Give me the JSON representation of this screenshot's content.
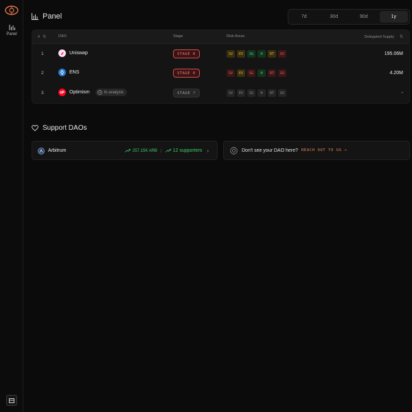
{
  "sidebar": {
    "logo_icon": "eye-logo-icon",
    "nav": [
      {
        "label": "Panel",
        "icon": "bar-chart-icon"
      }
    ],
    "bottom_icon": "sidebar-toggle-icon"
  },
  "header": {
    "title": "Panel",
    "title_icon": "bar-chart-icon",
    "ranges": [
      {
        "label": "7d",
        "active": false
      },
      {
        "label": "30d",
        "active": false
      },
      {
        "label": "90d",
        "active": false
      },
      {
        "label": "1y",
        "active": true
      }
    ]
  },
  "table": {
    "columns": {
      "rank": "#",
      "dao": "DAO",
      "stage": "Stage",
      "risk": "Risk Areas",
      "supply": "Delegated Supply"
    },
    "rows": [
      {
        "rank": "1",
        "name": "Uniswap",
        "icon": "uniswap-icon",
        "stage": "STAGE 0",
        "stage_style": "red",
        "risks": [
          {
            "code": "SV",
            "level": "medium"
          },
          {
            "code": "EV",
            "level": "medium"
          },
          {
            "code": "SG",
            "level": "low"
          },
          {
            "code": "H",
            "level": "low"
          },
          {
            "code": "RT",
            "level": "medium"
          },
          {
            "code": "GV",
            "level": "high"
          }
        ],
        "supply": "195.06M"
      },
      {
        "rank": "2",
        "name": "ENS",
        "icon": "ens-icon",
        "stage": "STAGE 0",
        "stage_style": "red",
        "risks": [
          {
            "code": "SV",
            "level": "high"
          },
          {
            "code": "EV",
            "level": "medium"
          },
          {
            "code": "SG",
            "level": "high"
          },
          {
            "code": "H",
            "level": "low"
          },
          {
            "code": "RT",
            "level": "high"
          },
          {
            "code": "GV",
            "level": "high"
          }
        ],
        "supply": "4.20M"
      },
      {
        "rank": "3",
        "name": "Optimism",
        "icon": "optimism-icon",
        "badge": "In analysis",
        "badge_icon": "clock-icon",
        "stage": "STAGE ?",
        "stage_style": "grey",
        "risks": [
          {
            "code": "SV",
            "level": "none"
          },
          {
            "code": "EV",
            "level": "none"
          },
          {
            "code": "SG",
            "level": "none"
          },
          {
            "code": "H",
            "level": "none"
          },
          {
            "code": "RT",
            "level": "none"
          },
          {
            "code": "GV",
            "level": "none"
          }
        ],
        "supply": "-"
      }
    ]
  },
  "support": {
    "title": "Support DAOs",
    "title_icon": "heart-icon",
    "arbitrum": {
      "name": "Arbitrum",
      "amount": "257.15K ARB",
      "supporters": "12 supporters"
    },
    "cta": {
      "text": "Don't see your DAO here?",
      "link": "REACH OUT TO US →"
    }
  },
  "colors": {
    "risk_high_bg": "#3b1717",
    "risk_high_fg": "#e0625c",
    "risk_medium_bg": "#3a2f10",
    "risk_medium_fg": "#e2b23b",
    "risk_low_bg": "#13331d",
    "risk_low_fg": "#4fd27a",
    "risk_none_bg": "#242424",
    "risk_none_fg": "#8a8a8a",
    "accent_orange": "#f08a5d",
    "positive_green": "#3ecf6b"
  }
}
